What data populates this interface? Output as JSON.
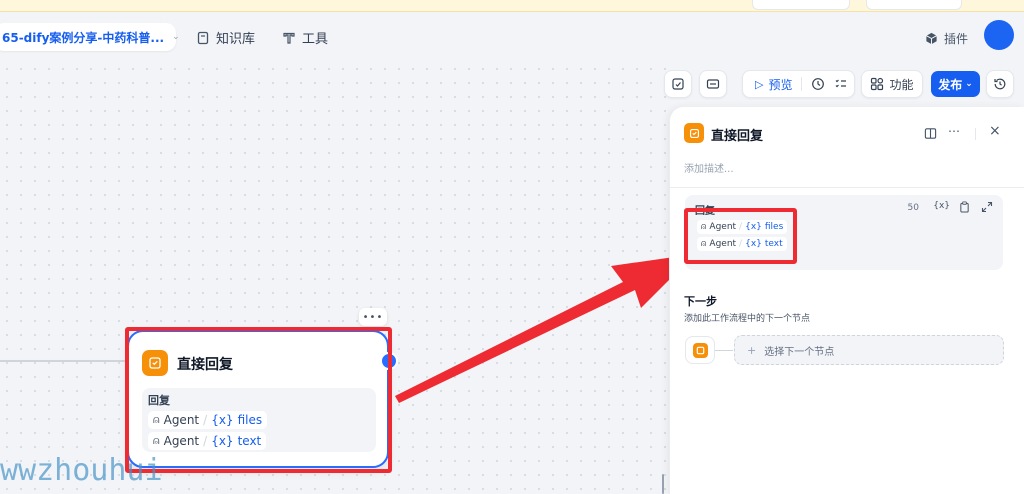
{
  "header": {
    "app_title": "65-dify案例分享-中药科普...",
    "nav": [
      {
        "label": "知识库",
        "icon": "book-icon"
      },
      {
        "label": "工具",
        "icon": "tool-icon"
      }
    ],
    "plugin_label": "插件"
  },
  "toolbar": {
    "preview_label": "预览",
    "features_label": "功能",
    "publish_label": "发布"
  },
  "node": {
    "title": "直接回复",
    "more": "•••",
    "reply_label": "回复",
    "vars": [
      {
        "source": "Agent",
        "name": "files"
      },
      {
        "source": "Agent",
        "name": "text"
      }
    ]
  },
  "panel": {
    "title": "直接回复",
    "description_placeholder": "添加描述...",
    "reply_label": "回复",
    "char_count": "50",
    "vars": [
      {
        "source": "Agent",
        "name": "files"
      },
      {
        "source": "Agent",
        "name": "text"
      }
    ],
    "next_step_title": "下一步",
    "next_step_desc": "添加此工作流程中的下一个节点",
    "select_next_label": "选择下一个节点"
  },
  "watermark": "wwzhouhui",
  "colors": {
    "accent": "#155eef",
    "node_icon": "#f79009",
    "highlight": "#ee2b32"
  }
}
